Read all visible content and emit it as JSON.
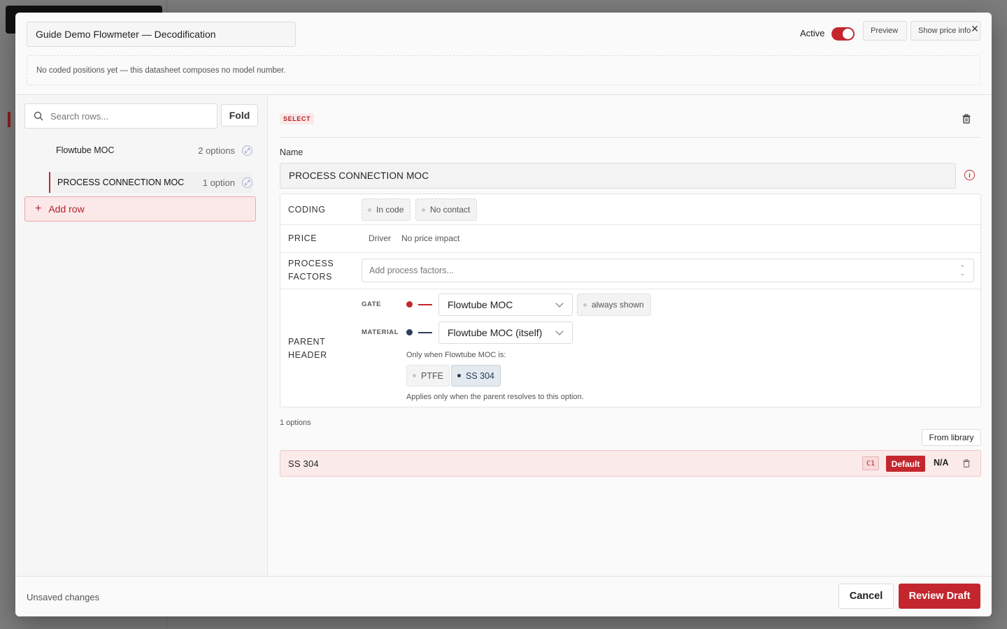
{
  "header": {
    "title_value": "Guide Demo Flowmeter — Decodification",
    "active_label": "Active",
    "active_on": true,
    "preview_label": "Preview",
    "price_info_label": "Show price info",
    "notice": "No coded positions yet — this datasheet composes no model number."
  },
  "sidebar": {
    "search_placeholder": "Search rows...",
    "fold_label": "Fold",
    "rows": [
      {
        "label": "Flowtube MOC",
        "count": "2 options"
      },
      {
        "label": "PROCESS CONNECTION MOC",
        "count": "1 option"
      }
    ],
    "add_row_label": "Add row"
  },
  "editor": {
    "type_badge": "SELECT",
    "name_label": "Name",
    "name_value": "PROCESS CONNECTION MOC",
    "coding": {
      "label": "CODING",
      "chips": [
        "In code",
        "No contact"
      ]
    },
    "price": {
      "label": "PRICE",
      "driver": "Driver",
      "impact": "No price impact"
    },
    "process_factors": {
      "label_line1": "PROCESS",
      "label_line2": "FACTORS",
      "placeholder": "Add process factors..."
    },
    "parent_header": {
      "label_line1": "PARENT",
      "label_line2": "HEADER",
      "gate_label": "GATE",
      "gate_value": "Flowtube MOC",
      "gate_chip": "always shown",
      "material_label": "MATERIAL",
      "material_value": "Flowtube MOC (itself)",
      "only_when": "Only when Flowtube MOC is:",
      "options": [
        "PTFE",
        "SS 304"
      ],
      "selected_option": "SS 304",
      "applies_note": "Applies only when the parent resolves to this option."
    },
    "options_count": "1 options",
    "from_library_label": "From library",
    "options": [
      {
        "name": "SS 304",
        "code": "C1",
        "default_label": "Default",
        "price": "N/A"
      }
    ]
  },
  "footer": {
    "status": "Unsaved changes",
    "cancel_label": "Cancel",
    "review_label": "Review Draft"
  },
  "colors": {
    "accent": "#c4262e",
    "gate_indicator": "#c4262e",
    "material_indicator": "#2f3e5c"
  }
}
